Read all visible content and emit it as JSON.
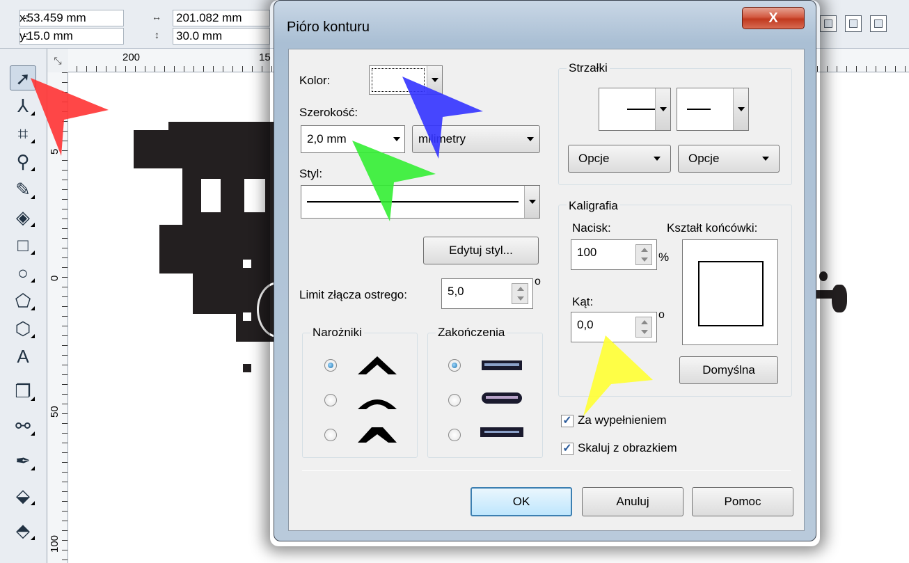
{
  "propbar": {
    "x_label": "x:",
    "x_value": "-53.459 mm",
    "y_label": "y:",
    "y_value": "-15.0 mm",
    "w_value": "201.082 mm",
    "h_value": "30.0 mm"
  },
  "rulers": {
    "h_ticks": [
      "200",
      "15"
    ],
    "v_ticks": [
      "5",
      "0",
      "50",
      "100"
    ]
  },
  "dialog": {
    "title": "Pióro konturu",
    "close_label": "X",
    "color_label": "Kolor:",
    "width_label": "Szerokość:",
    "width_value": "2,0 mm",
    "units_value": "milimetry",
    "style_label": "Styl:",
    "edit_style_label": "Edytuj styl...",
    "miter_label": "Limit złącza ostrego:",
    "miter_value": "5,0",
    "miter_unit": "o",
    "corners_title": "Narożniki",
    "caps_title": "Zakończenia",
    "arrows_title": "Strzałki",
    "options1_label": "Opcje",
    "options2_label": "Opcje",
    "calligraphy_title": "Kaligrafia",
    "stretch_label": "Nacisk:",
    "stretch_value": "100",
    "stretch_unit": "%",
    "nib_shape_label": "Kształt końcówki:",
    "angle_label": "Kąt:",
    "angle_value": "0,0",
    "angle_unit": "o",
    "default_label": "Domyślna",
    "behind_fill_label": "Za wypełnieniem",
    "behind_fill_checked": true,
    "scale_label": "Skaluj z obrazkiem",
    "scale_checked": true,
    "ok_label": "OK",
    "cancel_label": "Anuluj",
    "help_label": "Pomoc"
  },
  "colors": {
    "pointer_red": "#ff3333",
    "pointer_blue": "#3333ff",
    "pointer_green": "#33ee33",
    "pointer_yellow": "#ffff33"
  }
}
